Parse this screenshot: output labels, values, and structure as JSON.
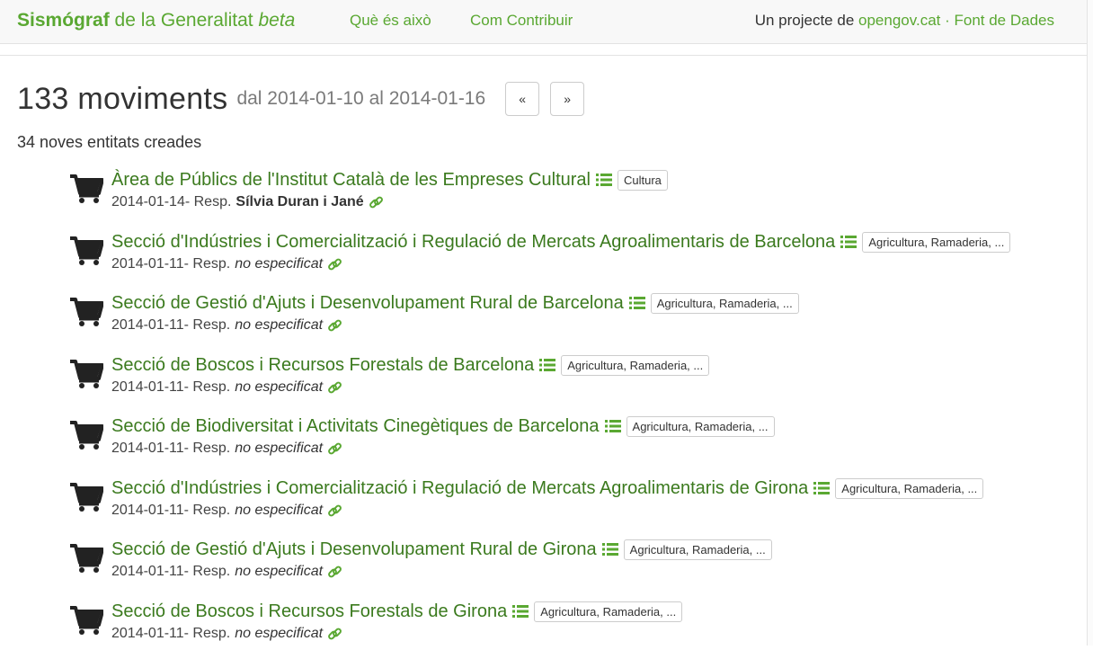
{
  "navbar": {
    "brand_bold": "Sismógraf",
    "brand_middle": " de la Generalitat ",
    "brand_italic": "beta",
    "links": [
      "Què és això",
      "Com Contribuir"
    ],
    "project_prefix": "Un projecte de ",
    "project_link": "opengov.cat",
    "separator": " · ",
    "data_link": "Font de Dades"
  },
  "header": {
    "count": "133 moviments",
    "range": "dal 2014-01-10 al 2014-01-16",
    "prev_label": "«",
    "next_label": "»",
    "subtitle": "34 noves entitats creades"
  },
  "entries": [
    {
      "name": "Àrea de Públics de l'Institut Català de les Empreses Cultural",
      "tag": "Cultura",
      "date": "2014-01-14",
      "resp_label": " - Resp.",
      "person": "Sílvia Duran i Jané"
    },
    {
      "name": "Secció d'Indústries i Comercialització i Regulació de Mercats Agroalimentaris de Barcelona",
      "tag": "Agricultura, Ramaderia, ...",
      "date": "2014-01-11",
      "resp_label": " - Resp.",
      "unspecified": "no especificat"
    },
    {
      "name": "Secció de Gestió d'Ajuts i Desenvolupament Rural de Barcelona",
      "tag": "Agricultura, Ramaderia, ...",
      "date": "2014-01-11",
      "resp_label": " - Resp.",
      "unspecified": "no especificat"
    },
    {
      "name": "Secció de Boscos i Recursos Forestals de Barcelona",
      "tag": "Agricultura, Ramaderia, ...",
      "date": "2014-01-11",
      "resp_label": " - Resp.",
      "unspecified": "no especificat"
    },
    {
      "name": "Secció de Biodiversitat i Activitats Cinegètiques de Barcelona",
      "tag": "Agricultura, Ramaderia, ...",
      "date": "2014-01-11",
      "resp_label": " - Resp.",
      "unspecified": "no especificat"
    },
    {
      "name": "Secció d'Indústries i Comercialització i Regulació de Mercats Agroalimentaris de Girona",
      "tag": "Agricultura, Ramaderia, ...",
      "date": "2014-01-11",
      "resp_label": " - Resp.",
      "unspecified": "no especificat"
    },
    {
      "name": "Secció de Gestió d'Ajuts i Desenvolupament Rural de Girona",
      "tag": "Agricultura, Ramaderia, ...",
      "date": "2014-01-11",
      "resp_label": " - Resp.",
      "unspecified": "no especificat"
    },
    {
      "name": "Secció de Boscos i Recursos Forestals de Girona",
      "tag": "Agricultura, Ramaderia, ...",
      "date": "2014-01-11",
      "resp_label": " - Resp.",
      "unspecified": "no especificat"
    }
  ],
  "icons": {
    "entry_icon": "shopping-cart-icon",
    "category_icon": "list-icon",
    "permalink_icon": "link-icon"
  },
  "colors": {
    "brand_green": "#5aa832",
    "link_green": "#3b7a1e"
  }
}
